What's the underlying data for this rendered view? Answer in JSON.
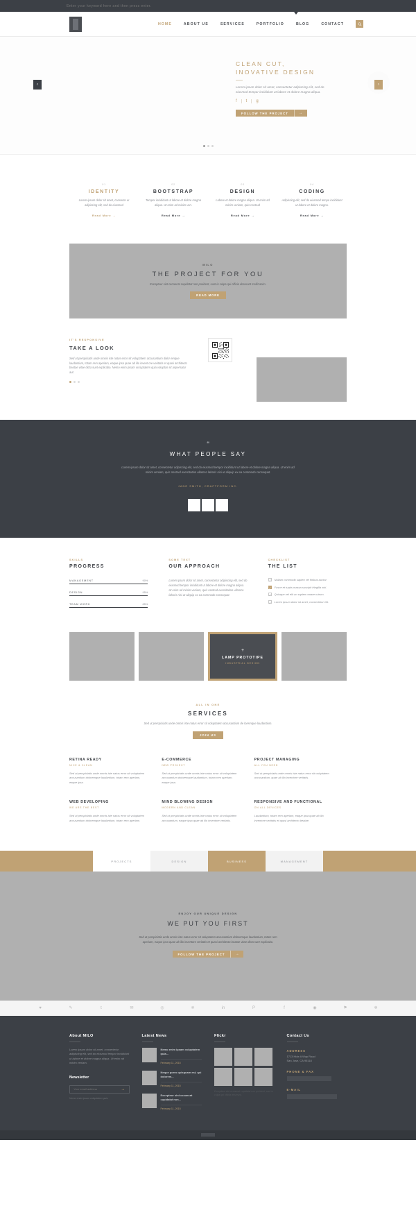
{
  "topbar": {
    "search_placeholder": "Enter your keyword here and then press enter."
  },
  "header": {
    "nav": [
      {
        "label": "HOME",
        "active": true
      },
      {
        "label": "ABOUT US",
        "active": false
      },
      {
        "label": "SERVICES",
        "active": false
      },
      {
        "label": "PORTFOLIO",
        "active": false
      },
      {
        "label": "BLOG",
        "active": false
      },
      {
        "label": "CONTACT",
        "active": false
      }
    ]
  },
  "hero": {
    "title_line1": "CLEAN CUT,",
    "title_line2": "INOVATIVE DESIGN",
    "subtitle": "Lorem ipsum dolor sit amet, consectetur adipiscing elit, sed do eiusmod tempor incididunt ut labore et dolore magna aliqua.",
    "social": [
      "f",
      "t",
      "g"
    ],
    "button_label": "FOLLOW THE PROJECT",
    "button_arrow": "→",
    "arrow_left": "‹",
    "arrow_right": "›"
  },
  "features": [
    {
      "num": "01",
      "title": "IDENTITY",
      "text": "Lorem ipsum dolor sit amet, consecte ur adipiscing elit, sed do eiusmod",
      "more": "Read More →",
      "gold": true
    },
    {
      "num": "02",
      "title": "BOOTSTRAP",
      "text": "Tempor incididunt ut labore et dolore magna aliqua. Ut enim ad minim ven.",
      "more": "Read More →",
      "gold": false
    },
    {
      "num": "03",
      "title": "DESIGN",
      "text": "Labore et dolore magna aliqua. Ut enim ad minim veniam, quis nostrud",
      "more": "Read More →",
      "gold": false
    },
    {
      "num": "04",
      "title": "CODING",
      "text": "Adipiscing elit, sed do eiusmod tempo incididunt ut labore et dolore magna.",
      "more": "Read More →",
      "gold": false
    }
  ],
  "banner": {
    "kicker": "MILO",
    "title": "THE PROJECT FOR YOU",
    "desc": "Excepteur sint occaecat cupidatat non proident, sunt in culpa qui officia deserunt mollit anim.",
    "button": "READ MORE"
  },
  "look": {
    "kicker": "IT'S RESPONSIVE",
    "title": "TAKE A LOOK",
    "text": "Sed ut perspiciatis unde omnis iste natus error sit voluptatem accusantium dolor emque laudantium, totam rem aperiam, eaque ipsa quae ab illo invent ore veritatis et quasi architecto beatae vitae dicta sunt explicabo. Nemo enim ipsam vo luptatem quia voluptas sit aspernatur aut."
  },
  "testimonials": {
    "quote_icon": "❝",
    "title": "WHAT PEOPLE SAY",
    "text": "Lorem ipsum dolor sit amet, consectetur adipiscing elit, sed do eiusmod tempor incididunt ut labore et dolore magna aliqua. Ut enim ad minim veniam, quis nostrud exercitation ullamco laboris nisi ut aliquip ex ea commodo consequat.",
    "author": "JANE SMITH, CRAFTFORM INC."
  },
  "skills": {
    "kicker": "SKILLS",
    "title": "PROGRESS",
    "bars": [
      {
        "name": "MANAGEMENT",
        "pct": "90%"
      },
      {
        "name": "DESIGN",
        "pct": "95%"
      },
      {
        "name": "TEAM WORK",
        "pct": "85%"
      }
    ]
  },
  "approach": {
    "kicker": "SOME TEXT",
    "title": "OUR APPROACH",
    "text": "Lorem ipsum dolor sit amet, consectetur adipiscing elit, sed do eiusmod tempor incididunt ut labore et dolore magna aliqua. Ut enim ad minim veniam, quis nostrud exercitation ullamco laboris nisi ut aliquip ex ea commodo consequat."
  },
  "checklist": {
    "kicker": "CHECKLIST",
    "title": "THE LIST",
    "items": [
      {
        "text": "Nullam commodo sapien vel finibus auctor.",
        "checked": false
      },
      {
        "text": "Fusce et turpis massa suscipit fringilla nisi.",
        "checked": true
      },
      {
        "text": "Quisque vel elit ac sapien ornare rutrum.",
        "checked": false
      },
      {
        "text": "Lorem ipsum dolor sit amet, consectetur elit.",
        "checked": false
      }
    ]
  },
  "portfolio": {
    "featured": {
      "plus": "+",
      "title": "LAMP PROTOTIPE",
      "sub": "INDUSTRIAL DESIGN"
    }
  },
  "services": {
    "kicker": "ALL IN ONE",
    "title": "SERVICES",
    "sub": "Sed ut perspiciatis unde omnis iste natus error sit voluptatem accusantium de loremque laudantium.",
    "button": "JOIN US",
    "items": [
      {
        "h": "RETINA READY",
        "k": "NICE & CLEAN",
        "t": "Sed ut perspiciatis unde omnis iste natus error sit voluptatem accusantium doloremque laudantium, totam rem aperiam, eaque ipsa."
      },
      {
        "h": "E-COMMERCE",
        "k": "NEW PROJECT",
        "t": "Sed ut perspiciatis unde omnis iste natus error sit voluptatem accusantium doloremque laudantium, totam rem aperiam, eaque ipsa."
      },
      {
        "h": "PROJECT MANAGING",
        "k": "ALL YOU NEED",
        "t": "Sed ut perspiciatis unde omnis iste natus error sit voluptatem accusantium, quae ab illo inventore veritatis."
      },
      {
        "h": "WEB DEVELOPING",
        "k": "WE ARE THE BEST",
        "t": "Sed ut perspiciatis unde omnis iste natus error sit voluptatem accusantium doloremque laudantium, totam rem aperiam."
      },
      {
        "h": "MIND BLOWING DESIGN",
        "k": "MODERN AND CLEAN",
        "t": "Sed ut perspiciatis unde omnis iste natus error sit voluptatem accusantium, eaque ipsa quae ab illo inventore veritatis."
      },
      {
        "h": "RESPONSIVE AND FUNCTIONAL",
        "k": "ON ALL DEVICES",
        "t": "Laudantium, totam rem aperiam, eaque ipsa quae ab illo inventore veritatis et quasi architecto beatae."
      }
    ]
  },
  "filters": [
    {
      "label": "PROJECTS",
      "style": "light"
    },
    {
      "label": "DESIGN",
      "style": "mid"
    },
    {
      "label": "BUSINESS",
      "style": "gold"
    },
    {
      "label": "MANAGEMENT",
      "style": "mid"
    }
  ],
  "cta": {
    "kicker": "ENJOY OUR UNIQUE DESIGN",
    "title": "WE PUT YOU FIRST",
    "text": "Sed ut perspiciatis unde omnis iste natus error sit voluptatem accusantium doloremque laudantium, totam rem aperiam, eaque ipsa quae ab illo inventore veritatis et quasi architecto beatae vitae dicta sunt explicabo.",
    "button": "FOLLOW THE PROJECT",
    "button_arrow": "→"
  },
  "social_strip": [
    "♥",
    "✎",
    "t",
    "✉",
    "◎",
    "✵",
    "in",
    "P",
    "f",
    "◉",
    "⚑",
    "❄"
  ],
  "footer": {
    "about": {
      "title": "About MILO",
      "text": "Lorem ipsum dolor sit amet, consectetur adipiscing elit, sed do eiusmod tempor incididunt ut labore et dolore magna aliqua. Ut enim ad minim veniam."
    },
    "newsletter": {
      "title": "Newsletter",
      "placeholder": "Your email address",
      "arrow": "→",
      "note": "Nemo enim ipsam voluptatem quia."
    },
    "latest_news": {
      "title": "Latest News",
      "items": [
        {
          "title": "Nemo enim ipsam voluptatem quia...",
          "date": "February 11, 2015"
        },
        {
          "title": "Neque porro quisquam est, qui dolorem...",
          "date": "February 11, 2015"
        },
        {
          "title": "Excepteur sint occaecat cupidatat non...",
          "date": "February 11, 2015"
        }
      ]
    },
    "flickr": {
      "title": "Flickr",
      "note": "Excepteur sint occaecat cupidatat non proident, sunt in culpa qui officia deserunt."
    },
    "contact": {
      "title": "Contact Us",
      "address_label": "ADDRESS",
      "address_value": "1713 Hide A Way Road\nSan Jose, CA 95118",
      "phone_label": "PHONE & FAX",
      "email_label": "E-MAIL"
    }
  }
}
